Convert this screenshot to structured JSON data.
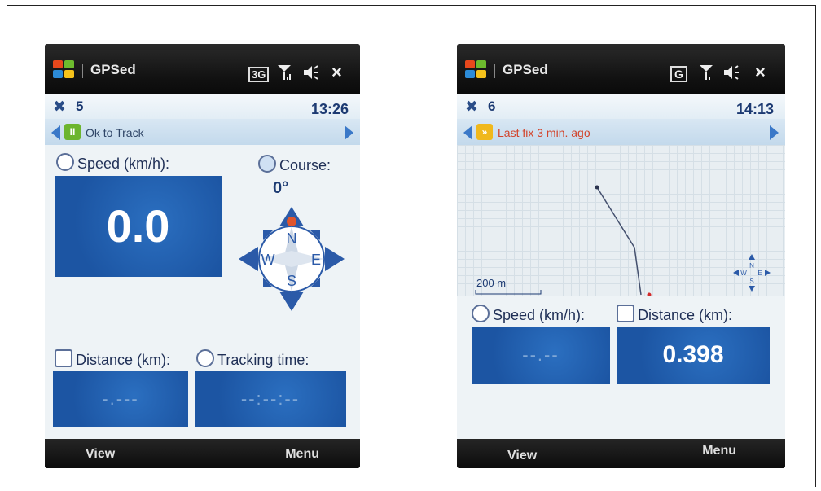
{
  "left_phone": {
    "app_name": "GPSed",
    "tray": {
      "network": "3G",
      "close": "×"
    },
    "satellite_count": "5",
    "clock": "13:26",
    "status": {
      "badge": "II",
      "text": "Ok to Track",
      "badge_color": "#6cb52e"
    },
    "speed_label": "Speed (km/h):",
    "speed_value": "0.0",
    "course_label": "Course:",
    "course_value": "0°",
    "compass": {
      "n": "N",
      "s": "S",
      "e": "E",
      "w": "W"
    },
    "distance_label": "Distance (km):",
    "distance_value": "-.---",
    "tracking_label": "Tracking time:",
    "tracking_value": "--:--:--",
    "softkey_left": "View",
    "softkey_right": "Menu"
  },
  "right_phone": {
    "app_name": "GPSed",
    "tray": {
      "network": "G",
      "close": "×"
    },
    "satellite_count": "6",
    "clock": "14:13",
    "status": {
      "badge": "»",
      "text": "Last fix 3 min. ago",
      "badge_color": "#f0b81c",
      "text_color": "#d2432a"
    },
    "map_scale": "200 m",
    "mini_compass": {
      "n": "N",
      "s": "S",
      "e": "E",
      "w": "W"
    },
    "speed_label": "Speed (km/h):",
    "speed_value": "--.--",
    "distance_label": "Distance (km):",
    "distance_value": "0.398",
    "softkey_left": "View",
    "softkey_right": "Menu"
  },
  "colors": {
    "accent_blue": "#1c55a3",
    "title_text": "#1c3a72"
  }
}
